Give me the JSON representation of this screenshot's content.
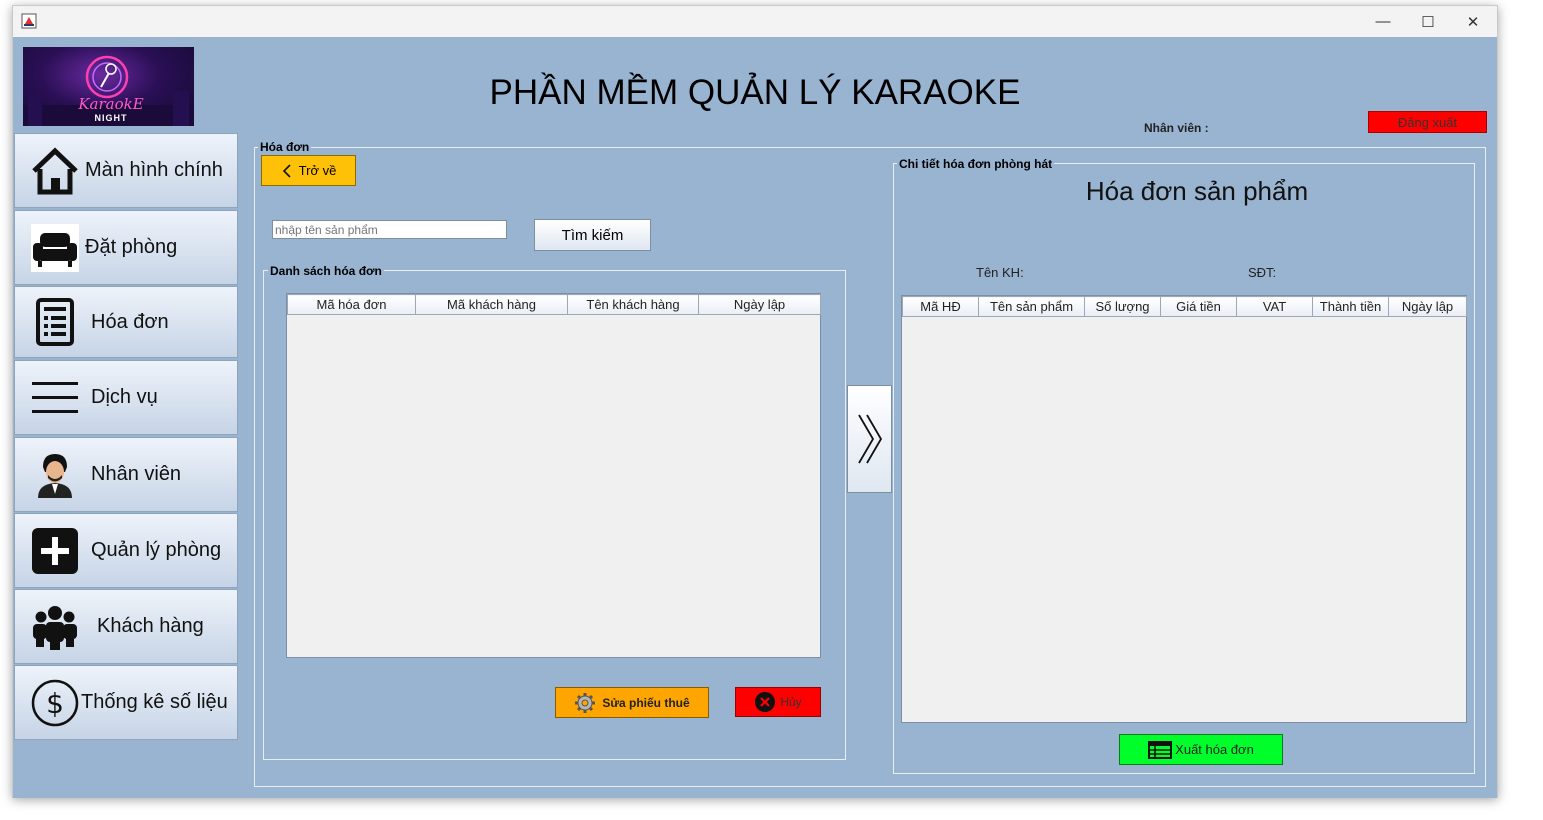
{
  "app_title": "PHẦN MỀM QUẢN LÝ KARAOKE",
  "logo": {
    "line1": "KaraokE",
    "line2": "NIGHT"
  },
  "window_controls": {
    "minimize": "—",
    "maximize": "☐",
    "close": "✕"
  },
  "header": {
    "employee_label": "Nhân viên :",
    "logout_label": "Đăng xuất"
  },
  "sidebar": {
    "items": [
      {
        "label": "Màn hình chính",
        "icon": "home-icon"
      },
      {
        "label": "Đặt phòng",
        "icon": "sofa-icon"
      },
      {
        "label": "Hóa đơn",
        "icon": "invoice-icon"
      },
      {
        "label": "Dịch vụ",
        "icon": "menu-lines-icon"
      },
      {
        "label": "Nhân viên",
        "icon": "employee-icon"
      },
      {
        "label": "Quản lý phòng",
        "icon": "plus-square-icon"
      },
      {
        "label": "Khách hàng",
        "icon": "group-icon"
      },
      {
        "label": "Thống kê số liệu",
        "icon": "dollar-circle-icon"
      }
    ]
  },
  "invoice_panel": {
    "legend": "Hóa đơn",
    "back_label": "Trở về",
    "search_placeholder": "nhập tên sản phẩm",
    "search_button": "Tìm kiếm",
    "list_legend": "Danh sách hóa đơn",
    "columns": [
      "Mã hóa đơn",
      "Mã khách hàng",
      "Tên khách hàng",
      "Ngày lập"
    ],
    "edit_button": "Sửa phiếu thuê",
    "cancel_button": "Hủy"
  },
  "detail_panel": {
    "legend": "Chi tiết hóa đơn phòng hát",
    "heading": "Hóa đơn sản phẩm",
    "customer_name_label": "Tên KH:",
    "phone_label": "SĐT:",
    "columns": [
      "Mã HĐ",
      "Tên sản phẩm",
      "Số lượng",
      "Giá tiền",
      "VAT",
      "Thành tiền",
      "Ngày lập"
    ],
    "export_button": "Xuất hóa đơn"
  },
  "colors": {
    "background": "#99b4d1",
    "logout": "#ff0000",
    "back": "#ffc107",
    "cancel": "#ff0000",
    "export": "#00ff2a"
  }
}
